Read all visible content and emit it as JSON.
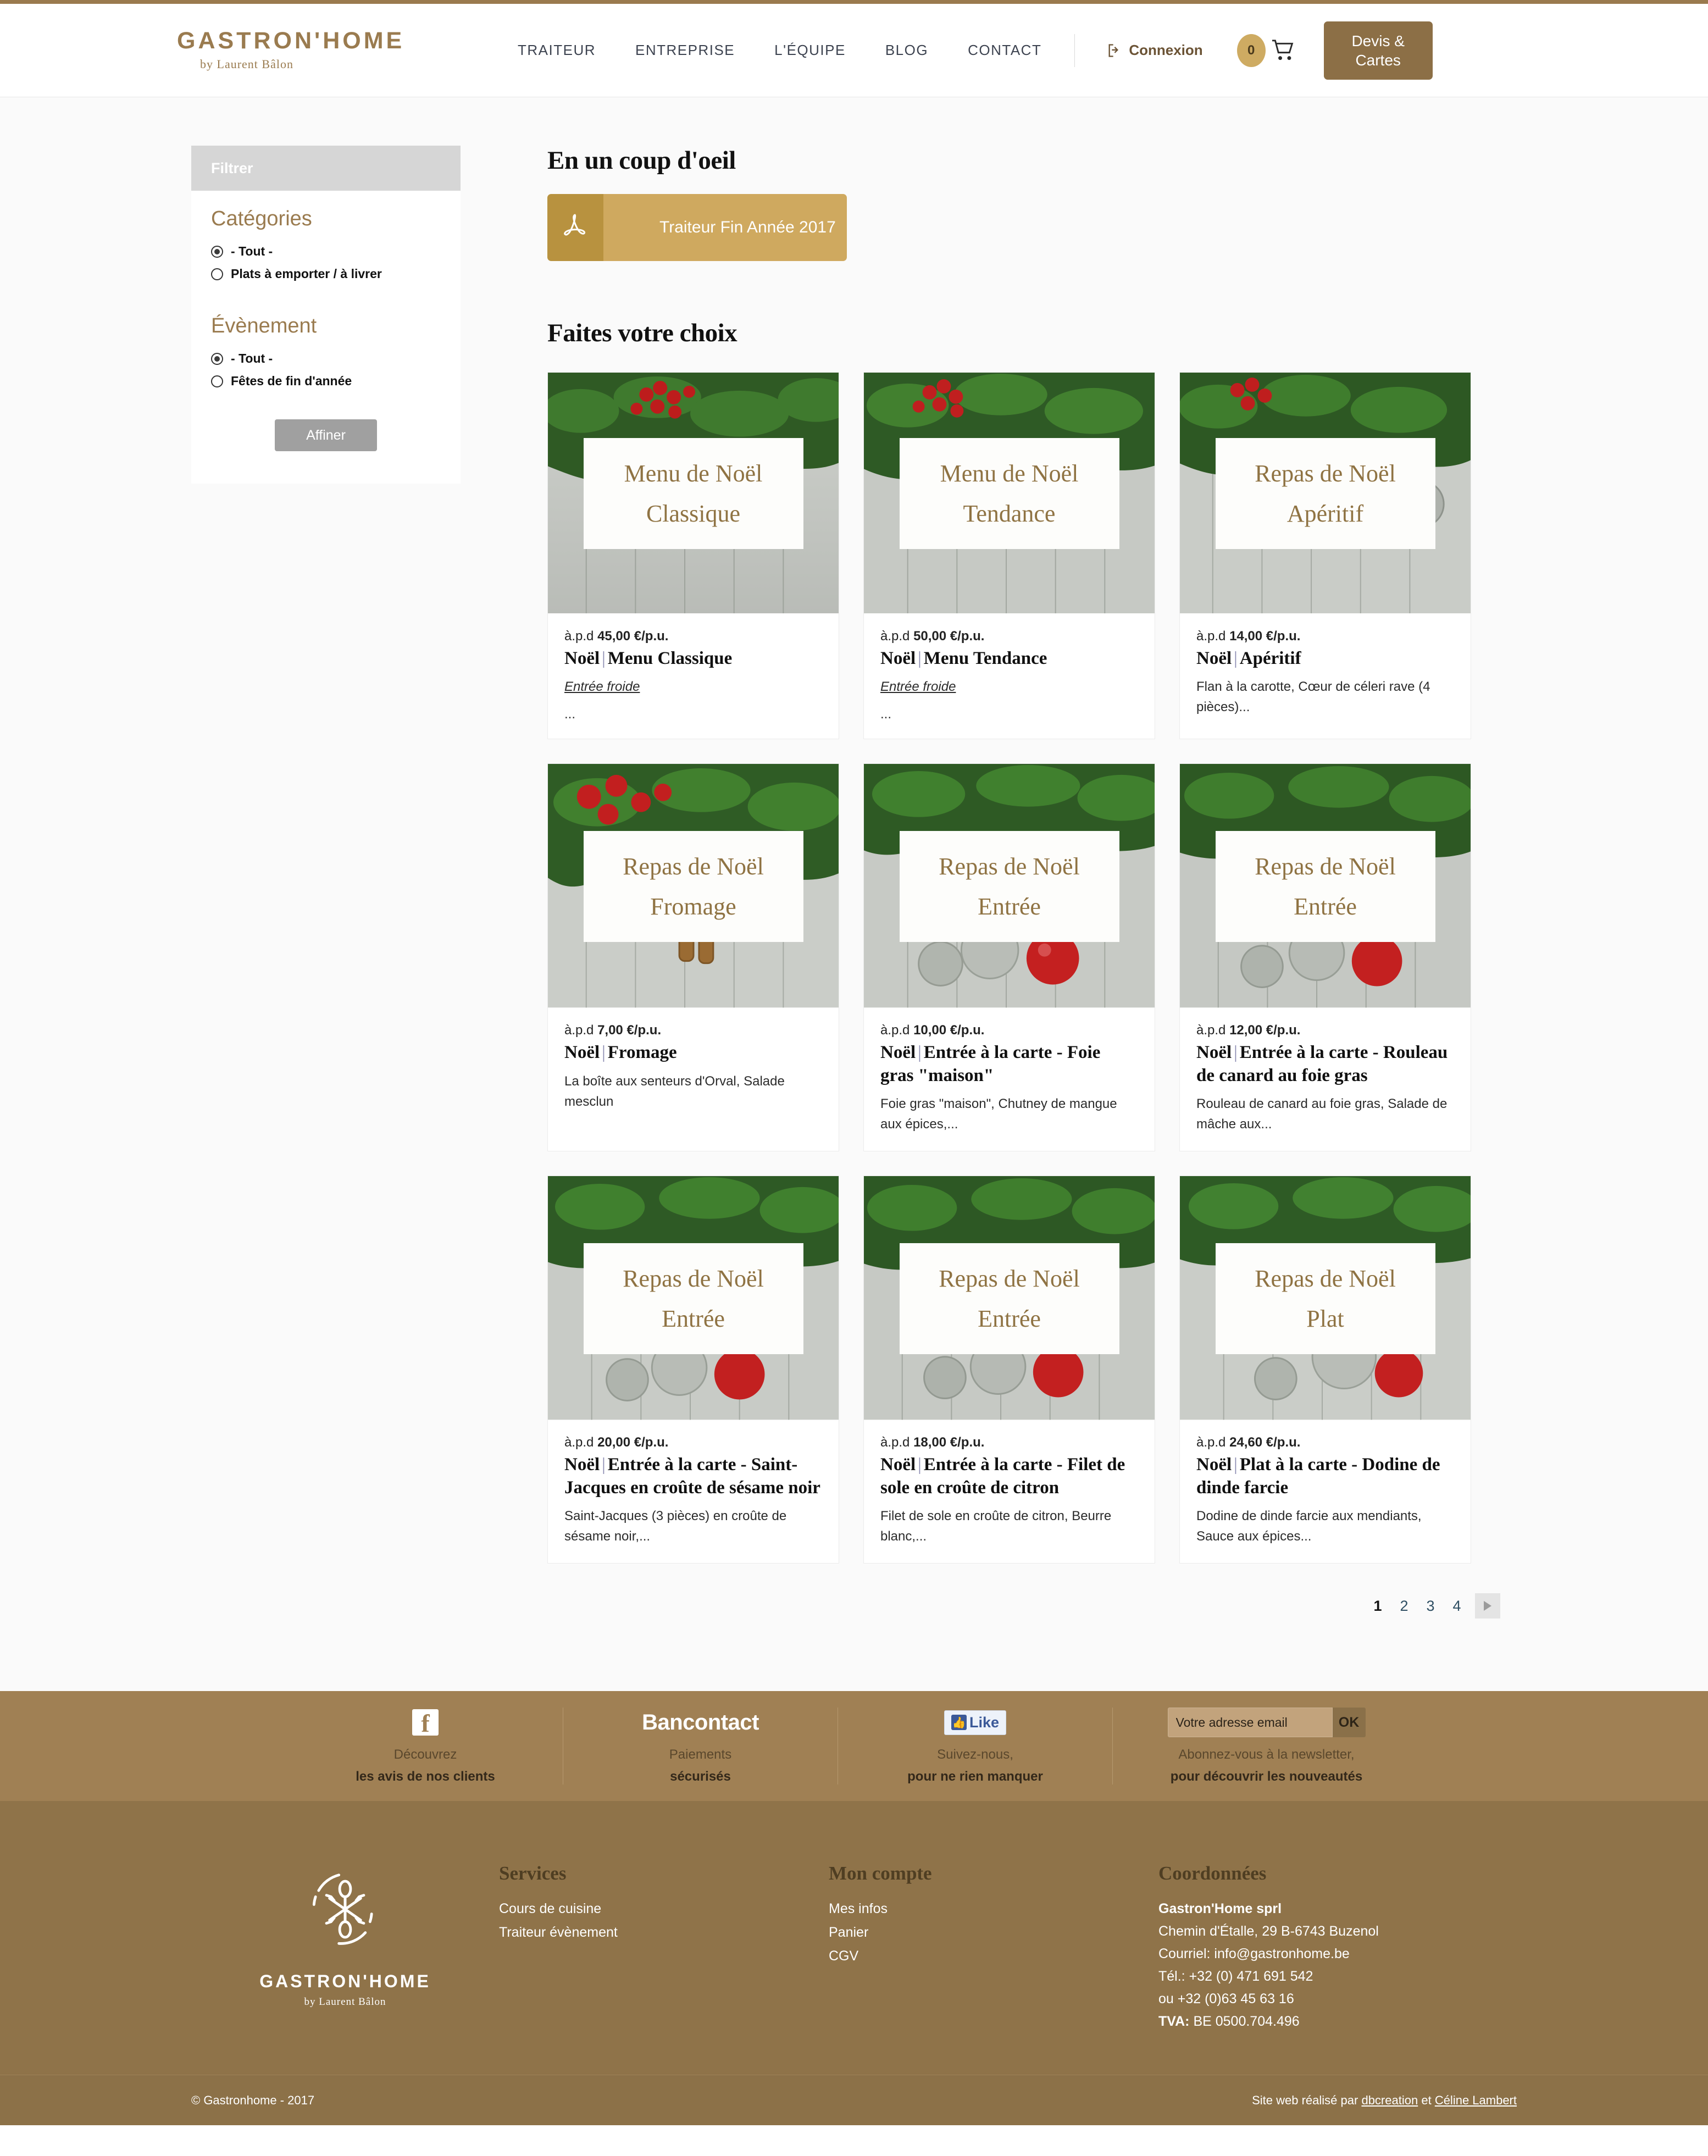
{
  "header": {
    "logo_main": "GASTRON'HOME",
    "logo_sub": "by Laurent Bâlon",
    "nav": [
      {
        "label": "TRAITEUR"
      },
      {
        "label": "ENTREPRISE"
      },
      {
        "label": "L'ÉQUIPE"
      },
      {
        "label": "BLOG"
      },
      {
        "label": "CONTACT"
      }
    ],
    "connexion_label": "Connexion",
    "cart_count": "0",
    "devis_line1": "Devis &",
    "devis_line2": "Cartes"
  },
  "sidebar": {
    "filtrer_label": "Filtrer",
    "groups": [
      {
        "title": "Catégories",
        "options": [
          {
            "label": "- Tout -",
            "selected": true
          },
          {
            "label": "Plats à emporter / à livrer",
            "selected": false
          }
        ]
      },
      {
        "title": "Évènement",
        "options": [
          {
            "label": "- Tout -",
            "selected": true
          },
          {
            "label": "Fêtes de fin d'année",
            "selected": false
          }
        ]
      }
    ],
    "affiner_label": "Affiner"
  },
  "main": {
    "heading_glance": "En un coup d'oeil",
    "pdf_label": "Traiteur Fin Année 2017",
    "heading_choice": "Faites votre choix",
    "cards": [
      {
        "overlay_line1": "Menu de Noël",
        "overlay_line2": "Classique",
        "price_prefix": "à.p.d",
        "price": "45,00 €/p.u.",
        "title_prefix": "Noël",
        "title_main": "Menu Classique",
        "desc": "Entrée froide",
        "desc_italic": true,
        "ellipsis": "..."
      },
      {
        "overlay_line1": "Menu de Noël",
        "overlay_line2": "Tendance",
        "price_prefix": "à.p.d",
        "price": "50,00 €/p.u.",
        "title_prefix": "Noël",
        "title_main": "Menu Tendance",
        "desc": "Entrée froide",
        "desc_italic": true,
        "ellipsis": "..."
      },
      {
        "overlay_line1": "Repas de Noël",
        "overlay_line2": "Apéritif",
        "price_prefix": "à.p.d",
        "price": "14,00 €/p.u.",
        "title_prefix": "Noël",
        "title_main": "Apéritif",
        "desc": "Flan à la carotte, Cœur de céleri rave (4 pièces)...",
        "desc_italic": false,
        "ellipsis": ""
      },
      {
        "overlay_line1": "Repas de Noël",
        "overlay_line2": "Fromage",
        "price_prefix": "à.p.d",
        "price": "7,00 €/p.u.",
        "title_prefix": "Noël",
        "title_main": "Fromage",
        "desc": "La boîte aux senteurs d'Orval, Salade mesclun",
        "desc_italic": false,
        "ellipsis": ""
      },
      {
        "overlay_line1": "Repas de Noël",
        "overlay_line2": "Entrée",
        "price_prefix": "à.p.d",
        "price": "10,00 €/p.u.",
        "title_prefix": "Noël",
        "title_main": "Entrée à la carte - Foie gras \"maison\"",
        "desc": "Foie gras \"maison\", Chutney de mangue aux épices,...",
        "desc_italic": false,
        "ellipsis": ""
      },
      {
        "overlay_line1": "Repas de Noël",
        "overlay_line2": "Entrée",
        "price_prefix": "à.p.d",
        "price": "12,00 €/p.u.",
        "title_prefix": "Noël",
        "title_main": "Entrée à la carte - Rouleau de canard au foie gras",
        "desc": "Rouleau de canard au foie gras, Salade de mâche aux...",
        "desc_italic": false,
        "ellipsis": ""
      },
      {
        "overlay_line1": "Repas de Noël",
        "overlay_line2": "Entrée",
        "price_prefix": "à.p.d",
        "price": "20,00 €/p.u.",
        "title_prefix": "Noël",
        "title_main": "Entrée à la carte - Saint-Jacques en croûte de sésame noir",
        "desc": "Saint-Jacques (3 pièces) en croûte de sésame noir,...",
        "desc_italic": false,
        "ellipsis": ""
      },
      {
        "overlay_line1": "Repas de Noël",
        "overlay_line2": "Entrée",
        "price_prefix": "à.p.d",
        "price": "18,00 €/p.u.",
        "title_prefix": "Noël",
        "title_main": "Entrée à la carte - Filet de sole en croûte de citron",
        "desc": "Filet de sole en croûte de citron, Beurre blanc,...",
        "desc_italic": false,
        "ellipsis": ""
      },
      {
        "overlay_line1": "Repas de Noël",
        "overlay_line2": "Plat",
        "price_prefix": "à.p.d",
        "price": "24,60 €/p.u.",
        "title_prefix": "Noël",
        "title_main": "Plat à la carte - Dodine de dinde farcie",
        "desc": "Dodine de dinde farcie aux mendiants, Sauce aux épices...",
        "desc_italic": false,
        "ellipsis": ""
      }
    ],
    "pagination": {
      "pages": [
        "1",
        "2",
        "3",
        "4"
      ],
      "active": "1"
    }
  },
  "promo": {
    "columns": [
      {
        "icon": "facebook-icon",
        "line1": "Découvrez",
        "line2": "les avis de nos clients"
      },
      {
        "icon": "bancontact-logo",
        "title": "Bancontact",
        "line1": "Paiements",
        "line2": "sécurisés"
      },
      {
        "icon": "facebook-like-icon",
        "like_label": "Like",
        "line1": "Suivez-nous,",
        "line2": "pour ne rien manquer"
      },
      {
        "icon": "newsletter-form",
        "placeholder": "Votre adresse email",
        "ok_label": "OK",
        "line1": "Abonnez-vous à la newsletter,",
        "line2": "pour découvrir les nouveautés"
      }
    ]
  },
  "footer": {
    "logo_name": "GASTRON'HOME",
    "logo_sub": "by Laurent Bâlon",
    "columns": [
      {
        "heading": "Services",
        "links": [
          "Cours de cuisine",
          "Traiteur évènement"
        ]
      },
      {
        "heading": "Mon compte",
        "links": [
          "Mes infos",
          "Panier",
          "CGV"
        ]
      }
    ],
    "contact": {
      "heading": "Coordonnées",
      "company": "Gastron'Home sprl",
      "address": "Chemin d'Étalle, 29 B-6743 Buzenol",
      "email_line": "Courriel: info@gastronhome.be",
      "tel_line": "Tél.: +32 (0) 471 691 542",
      "tel_line2": "ou +32 (0)63 45 63 16",
      "tva_label": "TVA:",
      "tva_value": "BE 0500.704.496"
    },
    "copyright": "© Gastronhome - 2017",
    "credit_prefix": "Site web réalisé par",
    "credit_link1": "dbcreation",
    "credit_sep": "et",
    "credit_link2": "Céline Lambert"
  },
  "colors": {
    "brand_gold": "#9a7b4f",
    "footer_brown": "#8f7349",
    "promo_brown": "#a08054",
    "pdf_gold": "#cfa95f"
  }
}
